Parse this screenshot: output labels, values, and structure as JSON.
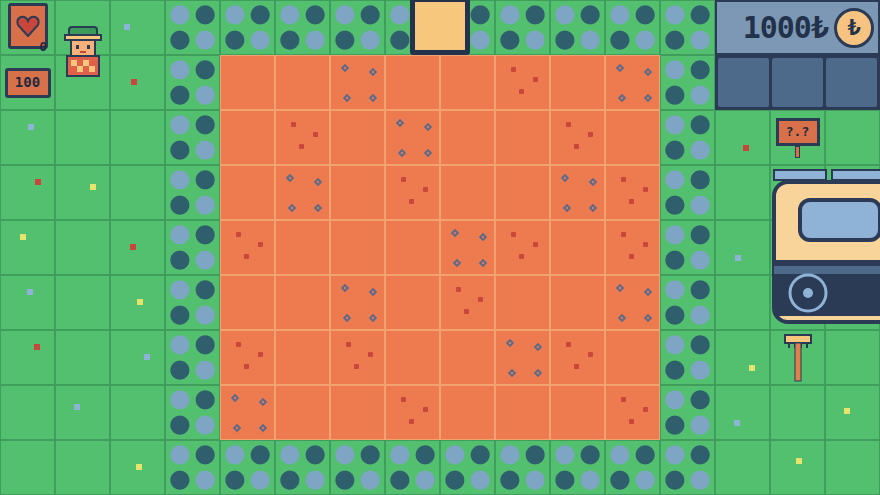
{
  "hud": {
    "lives": "0",
    "score": "100",
    "money": "1000₺",
    "coin_symbol": "₺"
  },
  "shop": {
    "sign": "?.?"
  },
  "field": {
    "rows": [
      [
        "plain",
        "plain",
        "blue",
        "plain",
        "plain",
        "red",
        "plain",
        "blue"
      ],
      [
        "plain",
        "red",
        "plain",
        "blue",
        "plain",
        "plain",
        "red",
        "plain"
      ],
      [
        "plain",
        "blue",
        "plain",
        "red",
        "plain",
        "plain",
        "blue",
        "red"
      ],
      [
        "red",
        "plain",
        "plain",
        "plain",
        "blue",
        "red",
        "plain",
        "red"
      ],
      [
        "plain",
        "plain",
        "blue",
        "plain",
        "red",
        "plain",
        "plain",
        "blue"
      ],
      [
        "red",
        "plain",
        "red",
        "plain",
        "plain",
        "blue",
        "red",
        "plain"
      ],
      [
        "blue",
        "plain",
        "plain",
        "red",
        "plain",
        "plain",
        "plain",
        "red"
      ]
    ]
  }
}
